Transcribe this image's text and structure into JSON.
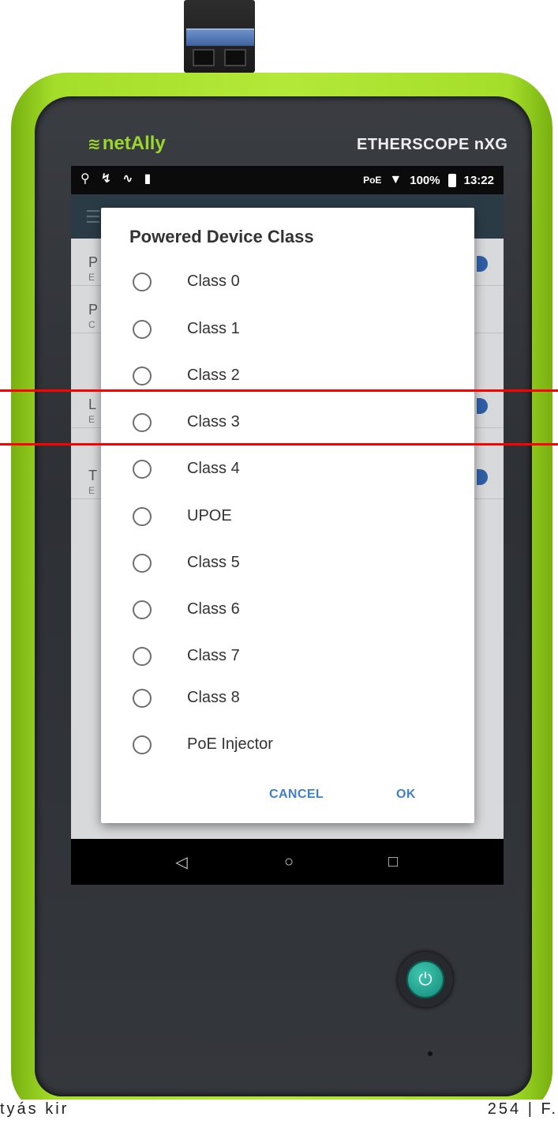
{
  "device": {
    "brand": "netAlly",
    "model": "ETHERSCOPE nXG",
    "brand_color": "#9bd62c",
    "bumper_color": "#a4de2a"
  },
  "status_bar": {
    "left_icons": [
      "search-icon",
      "share-icon",
      "waveform-icon",
      "sd-card-icon"
    ],
    "poe_label": "PoE",
    "battery": "100%",
    "time": "13:22"
  },
  "dialog": {
    "title": "Powered Device Class",
    "options": [
      {
        "label": "Class 0",
        "selected": false
      },
      {
        "label": "Class 1",
        "selected": false
      },
      {
        "label": "Class 2",
        "selected": false
      },
      {
        "label": "Class 3",
        "selected": false
      },
      {
        "label": "Class 4",
        "selected": false
      },
      {
        "label": "UPOE",
        "selected": false
      },
      {
        "label": "Class 5",
        "selected": false
      },
      {
        "label": "Class 6",
        "selected": false
      },
      {
        "label": "Class 7",
        "selected": false
      },
      {
        "label": "Class 8",
        "selected": false
      },
      {
        "label": "PoE Injector",
        "selected": false
      }
    ],
    "cancel_label": "CANCEL",
    "ok_label": "OK",
    "accent_color": "#3f7fce"
  },
  "background_rows": [
    {
      "t1": "P",
      "t2": "E"
    },
    {
      "t1": "P",
      "t2": "C"
    },
    {
      "t1": "L",
      "t2": "E"
    },
    {
      "t1": "T",
      "t2": "E"
    }
  ],
  "nav": {
    "back_icon": "back-triangle-icon",
    "home_icon": "home-circle-icon",
    "recents_icon": "recents-square-icon"
  },
  "footer": {
    "left": "tyás kir",
    "right": "254 | F."
  },
  "annotation_color": "#ff0000"
}
